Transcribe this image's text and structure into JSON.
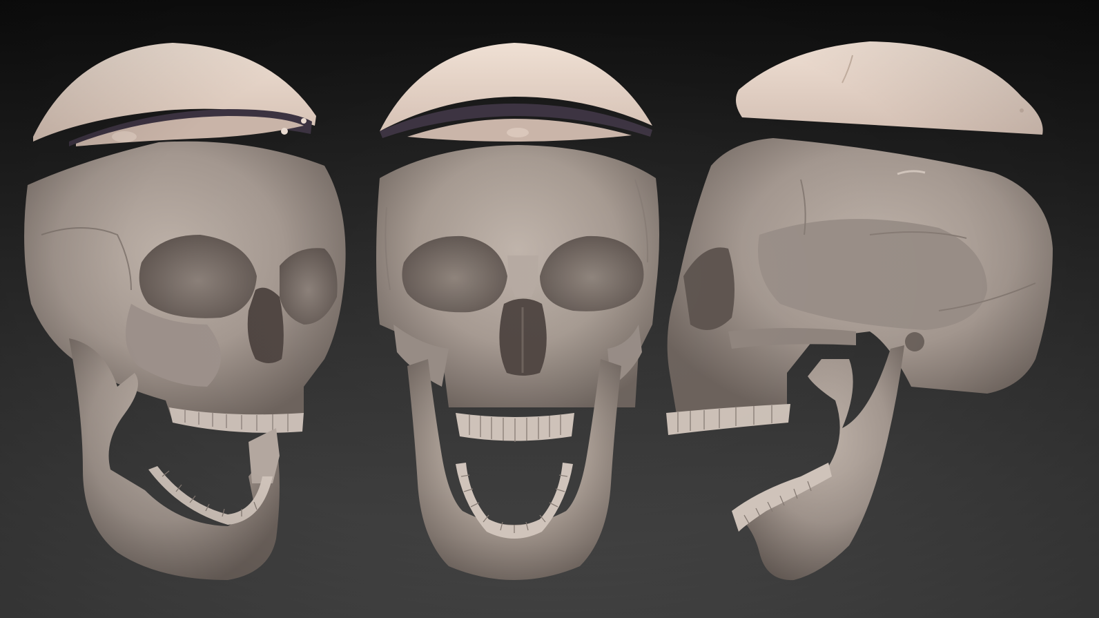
{
  "scene": {
    "background_top": "#0d0d0d",
    "background_bottom": "#454545",
    "bone_color": "#a89c94",
    "bone_highlight": "#cfc3ba",
    "bone_shadow": "#6f645e",
    "cap_color": "#e3d2c6",
    "cap_inner": "#c9b4a8",
    "cap_rim": "#3b3240",
    "views": [
      {
        "view": "three-quarter"
      },
      {
        "view": "front"
      },
      {
        "view": "side"
      }
    ]
  }
}
